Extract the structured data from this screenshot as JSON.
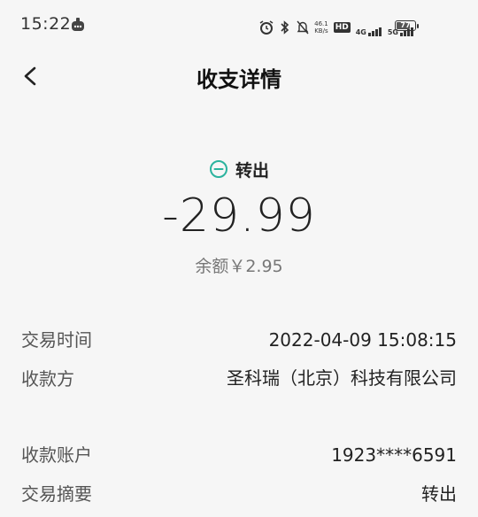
{
  "status_bar": {
    "time": "15:22",
    "network_speed_value": "46.1",
    "network_speed_unit": "KB/s",
    "hd_label": "HD",
    "sim1_network": "4G",
    "sim2_network": "5G",
    "battery_level": "77"
  },
  "header": {
    "title": "收支详情"
  },
  "summary": {
    "type_label": "转出",
    "amount": "-29.99",
    "balance": "余额￥2.95",
    "accent_color": "#2bb39e"
  },
  "details": {
    "rows": [
      {
        "label": "交易时间",
        "value": "2022-04-09 15:08:15"
      },
      {
        "label": "收款方",
        "value": "圣科瑞（北京）科技有限公司"
      },
      {
        "label": "收款账户",
        "value": "1923****6591"
      },
      {
        "label": "交易摘要",
        "value": "转出"
      }
    ]
  }
}
